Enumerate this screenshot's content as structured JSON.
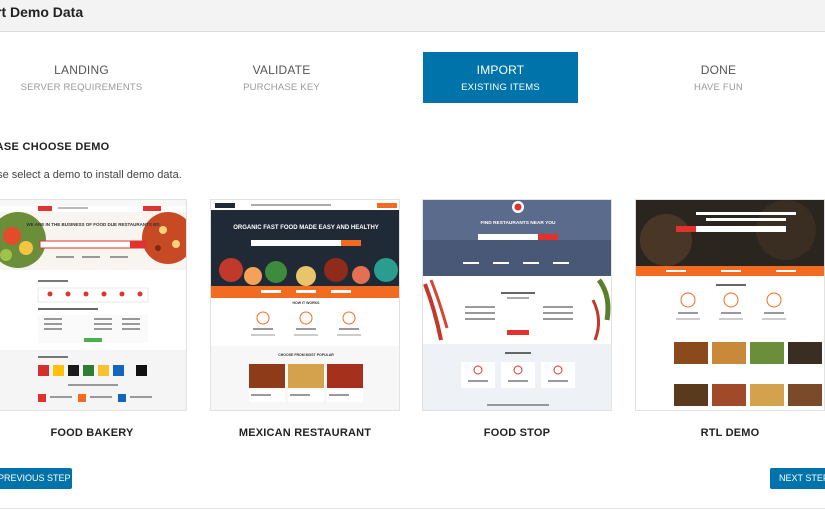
{
  "window": {
    "title": "rt Demo Data"
  },
  "steps": [
    {
      "label": "LANDING",
      "sub": "SERVER REQUIREMENTS",
      "active": false
    },
    {
      "label": "VALIDATE",
      "sub": "PURCHASE KEY",
      "active": false
    },
    {
      "label": "IMPORT",
      "sub": "EXISTING ITEMS",
      "active": true
    },
    {
      "label": "DONE",
      "sub": "HAVE FUN",
      "active": false
    }
  ],
  "section": {
    "title": "EASE CHOOSE DEMO",
    "description": "ase select a demo to install demo data."
  },
  "demos": [
    {
      "name": "FOOD BAKERY",
      "icon": "food-bakery-preview-image",
      "hero_text": "WE ARE IN THE BUSINESS OF FOOD DUE RESTAURANTS BD"
    },
    {
      "name": "MEXICAN RESTAURANT",
      "icon": "mexican-restaurant-preview-image",
      "hero_text": "ORGANIC FAST FOOD MADE EASY AND HEALTHY",
      "section_text": "HOW IT WORKS",
      "section_text_2": "CHOOSE FROM MOST POPULAR"
    },
    {
      "name": "FOOD STOP",
      "icon": "food-stop-preview-image",
      "hero_text": "FIND RESTAURANTS NEAR YOU"
    },
    {
      "name": "RTL DEMO",
      "icon": "rtl-demo-preview-image"
    }
  ],
  "buttons": {
    "previous": "PREVIOUS STEP",
    "next": "NEXT STEP"
  },
  "colors": {
    "accent": "#0073aa",
    "brand_red": "#e2322f",
    "brand_orange": "#f26b21",
    "dark_header": "#1f2a36"
  }
}
